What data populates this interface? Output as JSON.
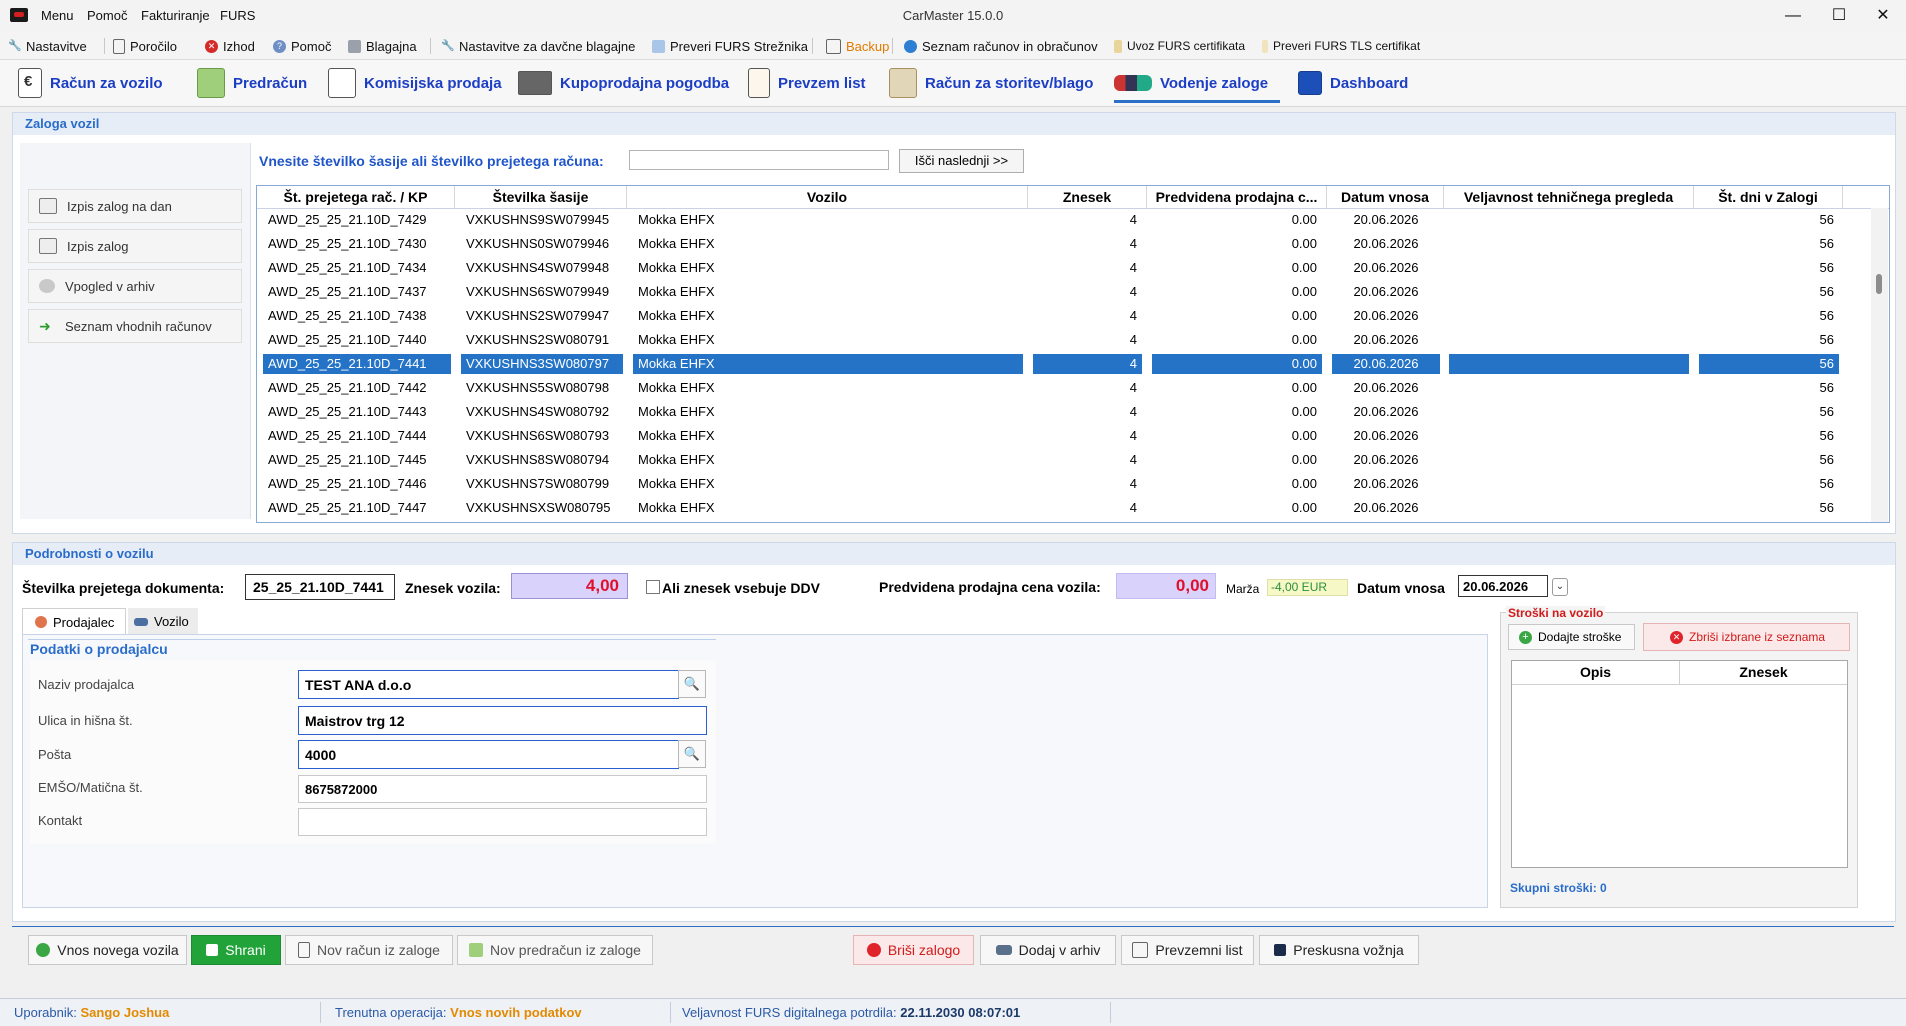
{
  "window": {
    "title": "CarMaster 15.0.0",
    "menu": [
      "Menu",
      "Pomoč",
      "Fakturiranje",
      "FURS"
    ],
    "controls": {
      "minimize": "—",
      "maximize": "☐",
      "close": "✕"
    }
  },
  "toolbar": {
    "items": [
      {
        "label": "Nastavitve",
        "icon": "wrench-icon"
      },
      {
        "label": "Poročilo",
        "icon": "report-icon"
      },
      {
        "label": "Izhod",
        "icon": "exit-icon"
      },
      {
        "label": "Pomoč",
        "icon": "help-icon"
      },
      {
        "label": "Blagajna",
        "icon": "cashbox-icon"
      },
      {
        "label": "Nastavitve za davčne blagajne",
        "icon": "wrench-icon"
      },
      {
        "label": "Preveri FURS Strežnika",
        "icon": "server-icon"
      },
      {
        "label": "Backup",
        "icon": "backup-icon"
      },
      {
        "label": "Seznam računov in obračunov",
        "icon": "list-icon"
      },
      {
        "label": "Uvoz FURS certifikata",
        "icon": "certificate-icon"
      },
      {
        "label": "Preveri FURS TLS certifikat",
        "icon": "certificate-icon"
      }
    ]
  },
  "module_tabs": [
    {
      "label": "Račun za vozilo"
    },
    {
      "label": "Predračun"
    },
    {
      "label": "Komisijska prodaja"
    },
    {
      "label": "Kupoprodajna pogodba"
    },
    {
      "label": "Prevzem list"
    },
    {
      "label": "Račun za storitev/blago"
    },
    {
      "label": "Vodenje zaloge"
    },
    {
      "label": "Dashboard"
    }
  ],
  "stock": {
    "header": "Zaloga vozil",
    "search_label": "Vnesite številko šasije ali številko prejetega računa:",
    "search_value": "",
    "search_button": "Išči naslednji >>",
    "side_buttons": [
      "Izpis zalog na dan",
      "Izpis zalog",
      "Vpogled v arhiv",
      "Seznam vhodnih računov"
    ],
    "columns": [
      "Št. prejetega rač. / KP",
      "Številka šasije",
      "Vozilo",
      "Znesek",
      "Predvidena prodajna c...",
      "Datum vnosa",
      "Veljavnost tehničnega pregleda",
      "Št. dni v Zalogi"
    ],
    "rows": [
      [
        "AWD_25_25_21.10D_7429",
        "VXKUSHNS9SW079945",
        "Mokka EHFX",
        "4",
        "0.00",
        "20.06.2026",
        "",
        "56"
      ],
      [
        "AWD_25_25_21.10D_7430",
        "VXKUSHNS0SW079946",
        "Mokka EHFX",
        "4",
        "0.00",
        "20.06.2026",
        "",
        "56"
      ],
      [
        "AWD_25_25_21.10D_7434",
        "VXKUSHNS4SW079948",
        "Mokka EHFX",
        "4",
        "0.00",
        "20.06.2026",
        "",
        "56"
      ],
      [
        "AWD_25_25_21.10D_7437",
        "VXKUSHNS6SW079949",
        "Mokka EHFX",
        "4",
        "0.00",
        "20.06.2026",
        "",
        "56"
      ],
      [
        "AWD_25_25_21.10D_7438",
        "VXKUSHNS2SW079947",
        "Mokka EHFX",
        "4",
        "0.00",
        "20.06.2026",
        "",
        "56"
      ],
      [
        "AWD_25_25_21.10D_7440",
        "VXKUSHNS2SW080791",
        "Mokka EHFX",
        "4",
        "0.00",
        "20.06.2026",
        "",
        "56"
      ],
      [
        "AWD_25_25_21.10D_7441",
        "VXKUSHNS3SW080797",
        "Mokka EHFX",
        "4",
        "0.00",
        "20.06.2026",
        "",
        "56"
      ],
      [
        "AWD_25_25_21.10D_7442",
        "VXKUSHNS5SW080798",
        "Mokka EHFX",
        "4",
        "0.00",
        "20.06.2026",
        "",
        "56"
      ],
      [
        "AWD_25_25_21.10D_7443",
        "VXKUSHNS4SW080792",
        "Mokka EHFX",
        "4",
        "0.00",
        "20.06.2026",
        "",
        "56"
      ],
      [
        "AWD_25_25_21.10D_7444",
        "VXKUSHNS6SW080793",
        "Mokka EHFX",
        "4",
        "0.00",
        "20.06.2026",
        "",
        "56"
      ],
      [
        "AWD_25_25_21.10D_7445",
        "VXKUSHNS8SW080794",
        "Mokka EHFX",
        "4",
        "0.00",
        "20.06.2026",
        "",
        "56"
      ],
      [
        "AWD_25_25_21.10D_7446",
        "VXKUSHNS7SW080799",
        "Mokka EHFX",
        "4",
        "0.00",
        "20.06.2026",
        "",
        "56"
      ],
      [
        "AWD_25_25_21.10D_7447",
        "VXKUSHNSXSW080795",
        "Mokka EHFX",
        "4",
        "0.00",
        "20.06.2026",
        "",
        "56"
      ]
    ],
    "selected_row": 6
  },
  "details": {
    "header": "Podrobnosti o vozilu",
    "doc_label": "Številka prejetega dokumenta:",
    "doc_value": "25_25_21.10D_7441",
    "amount_label": "Znesek vozila:",
    "amount_value": "4,00",
    "vat_label": "Ali znesek vsebuje DDV",
    "sale_label": "Predvidena prodajna cena vozila:",
    "sale_value": "0,00",
    "margin_label": "Marža",
    "margin_value": "-4,00 EUR",
    "date_label": "Datum vnosa",
    "date_value": "20.06.2026",
    "tabs": [
      "Prodajalec",
      "Vozilo"
    ],
    "seller_title": "Podatki o prodajalcu",
    "fields": [
      {
        "label": "Naziv prodajalca",
        "value": "TEST ANA d.o.o"
      },
      {
        "label": "Ulica in hišna št.",
        "value": "Maistrov trg 12"
      },
      {
        "label": "Pošta",
        "value": "4000"
      },
      {
        "label": "EMŠO/Matična št.",
        "value": "8675872000"
      },
      {
        "label": "Kontakt",
        "value": ""
      }
    ],
    "costs": {
      "title": "Stroški na vozilo",
      "add_button": "Dodajte stroške",
      "delete_button": "Zbriši izbrane iz seznama",
      "columns": [
        "Opis",
        "Znesek"
      ],
      "total": "Skupni stroški: 0"
    }
  },
  "bottom_buttons": [
    "Vnos novega vozila",
    "Shrani",
    "Nov račun iz zaloge",
    "Nov predračun iz zaloge",
    "Briši zalogo",
    "Dodaj v arhiv",
    "Prevzemni list",
    "Preskusna vožnja"
  ],
  "status": {
    "user_label": "Uporabnik:",
    "user": "Sango Joshua",
    "op_label": "Trenutna operacija:",
    "op": "Vnos novih podatkov",
    "cert_label": "Veljavnost FURS digitalnega potrdila:",
    "cert": "22.11.2030 08:07:01"
  },
  "colors": {
    "accent": "#2a6cc9",
    "selected_row": "#2473c7",
    "save_button": "#22a33a",
    "amount_bg": "#d9d2fb",
    "amount_text": "#e0102d",
    "margin_bg": "#f6f8c6"
  }
}
